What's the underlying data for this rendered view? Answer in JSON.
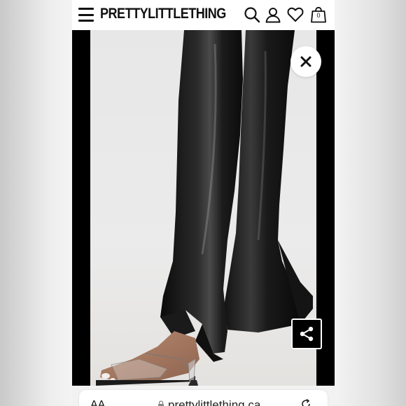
{
  "header": {
    "logo_text": "PRETTYLITTLETHING",
    "cart_count": "0",
    "icons": [
      "menu-icon",
      "search-icon",
      "account-icon",
      "heart-icon",
      "bag-icon"
    ]
  },
  "gallery": {
    "close_icon": "close-icon",
    "share_icon": "share-icon"
  },
  "browser": {
    "text_size_label": "AA",
    "url": "prettylittlething.ca",
    "lock_icon": "lock-icon",
    "reload_icon": "reload-icon"
  },
  "colors": {
    "brand": "#111111",
    "share_button_bg": "#000000",
    "close_button_bg": "#ffffff"
  }
}
